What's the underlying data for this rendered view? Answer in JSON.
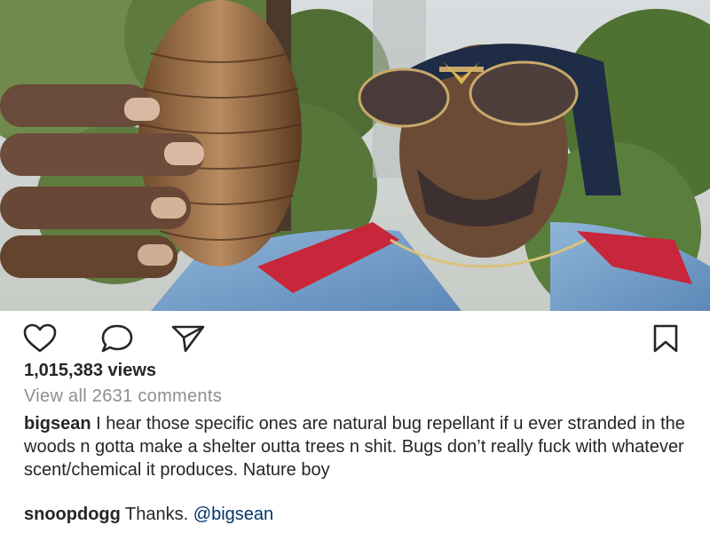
{
  "media": {
    "description_icon": "video-frame"
  },
  "actions": {
    "like_icon": "heart-icon",
    "comment_icon": "comment-bubble-icon",
    "share_icon": "paper-plane-icon",
    "save_icon": "bookmark-icon"
  },
  "stats": {
    "views_text": "1,015,383 views",
    "view_all_comments": "View all 2631 comments"
  },
  "caption": {
    "username": "bigsean",
    "text": " I hear those specific ones are natural bug repellant if u ever stranded in the woods n gotta make a shelter outta trees n shit. Bugs don’t really fuck with whatever scent/chemical it produces. Nature boy"
  },
  "comment": {
    "username": "snoopdogg",
    "text": " Thanks. ",
    "mention": "@bigsean"
  },
  "colors": {
    "text": "#262626",
    "muted": "#8e8e8e",
    "mention": "#003569"
  }
}
